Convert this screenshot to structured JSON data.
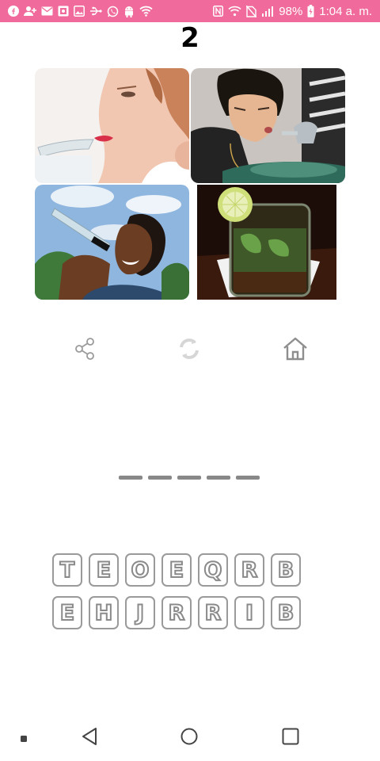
{
  "status_bar": {
    "battery": "98%",
    "time": "1:04 a. m.",
    "icons_left": [
      "facebook-icon",
      "add-contact-icon",
      "mail-icon",
      "gallery-icon",
      "image-icon",
      "usb-icon",
      "whatsapp-icon",
      "android-icon",
      "wifi-icon"
    ],
    "icons_right": [
      "nfc-icon",
      "wifi-icon",
      "no-sim-icon",
      "signal-icon",
      "battery-charging-icon"
    ]
  },
  "level": "2",
  "photos": [
    "woman-drinking-glass-photo",
    "boy-drinking-fountain-photo",
    "woman-drinking-bottle-photo",
    "mojito-glass-photo"
  ],
  "actions": [
    "share-icon",
    "refresh-icon",
    "home-icon"
  ],
  "answer": {
    "slots": 5
  },
  "letters": {
    "row1": [
      "T",
      "E",
      "O",
      "E",
      "Q",
      "R",
      "B"
    ],
    "row2": [
      "E",
      "H",
      "J",
      "R",
      "R",
      "I",
      "B"
    ]
  },
  "navigation": [
    "nav-dot",
    "back-triangle-icon",
    "home-circle-icon",
    "recent-square-icon"
  ],
  "colors": {
    "status_bar": "#f06b9b",
    "tile_border": "#9a9a9a",
    "slot": "#888888"
  }
}
